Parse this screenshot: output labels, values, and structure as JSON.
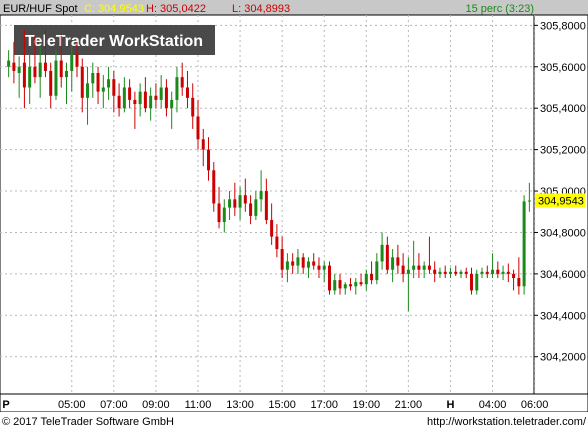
{
  "header": {
    "symbol": "EUR/HUF Spot",
    "close_label": "C: 304,9543",
    "high_label": "H: 305,0422",
    "low_label": "L: 304,8993",
    "period": "15 perc (3:23)"
  },
  "watermark": "TeleTrader WorkStation",
  "footer": {
    "copyright": "© 2017 TeleTrader Software GmbH",
    "url": "http://workstation.teletrader.com/"
  },
  "colors": {
    "up": "#1a8a1a",
    "down": "#cc0000",
    "grid": "#b8b8b8",
    "header_bg": "#c8c8c8",
    "close_highlight": "#ffff00",
    "price_marker": "#ffff00",
    "close_text": "#ffff00",
    "high_text": "#cc0000",
    "low_text": "#cc0000",
    "period_text": "#1a8a1a"
  },
  "chart_data": {
    "type": "candlestick",
    "y_ticks": [
      "305,8000",
      "305,6000",
      "305,4000",
      "305,2000",
      "305,0000",
      "304,8000",
      "304,6000",
      "304,4000",
      "304,2000"
    ],
    "y_tick_values": [
      305.8,
      305.6,
      305.4,
      305.2,
      305.0,
      304.8,
      304.6,
      304.4,
      304.2
    ],
    "ylim": [
      304.02,
      305.85
    ],
    "x_ticks": [
      "P",
      "05:00",
      "07:00",
      "09:00",
      "11:00",
      "13:00",
      "15:00",
      "17:00",
      "19:00",
      "21:00",
      "H",
      "04:00",
      "06:00"
    ],
    "x_tick_slots": [
      0,
      12,
      20,
      28,
      36,
      44,
      52,
      60,
      68,
      76,
      84,
      92,
      100
    ],
    "last_price_label": "304,9543",
    "last_price": 304.9543,
    "ohlc": [
      [
        305.6,
        305.68,
        305.55,
        305.63
      ],
      [
        305.62,
        305.72,
        305.52,
        305.58
      ],
      [
        305.57,
        305.65,
        305.45,
        305.6
      ],
      [
        305.62,
        305.78,
        305.4,
        305.5
      ],
      [
        305.5,
        305.66,
        305.42,
        305.6
      ],
      [
        305.6,
        305.75,
        305.52,
        305.55
      ],
      [
        305.55,
        305.7,
        305.45,
        305.62
      ],
      [
        305.62,
        305.78,
        305.55,
        305.58
      ],
      [
        305.58,
        305.62,
        305.4,
        305.46
      ],
      [
        305.46,
        305.68,
        305.44,
        305.63
      ],
      [
        305.63,
        305.75,
        305.5,
        305.55
      ],
      [
        305.55,
        305.62,
        305.42,
        305.58
      ],
      [
        305.58,
        305.7,
        305.48,
        305.66
      ],
      [
        305.66,
        305.72,
        305.55,
        305.6
      ],
      [
        305.6,
        305.64,
        305.38,
        305.45
      ],
      [
        305.45,
        305.6,
        305.32,
        305.52
      ],
      [
        305.52,
        305.62,
        305.45,
        305.57
      ],
      [
        305.57,
        305.6,
        305.42,
        305.48
      ],
      [
        305.48,
        305.56,
        305.4,
        305.5
      ],
      [
        305.5,
        305.6,
        305.44,
        305.54
      ],
      [
        305.54,
        305.58,
        305.38,
        305.46
      ],
      [
        305.46,
        305.52,
        305.36,
        305.4
      ],
      [
        305.4,
        305.55,
        305.38,
        305.5
      ],
      [
        305.5,
        305.54,
        305.4,
        305.44
      ],
      [
        305.44,
        305.48,
        305.3,
        305.42
      ],
      [
        305.42,
        305.52,
        305.36,
        305.48
      ],
      [
        305.48,
        305.55,
        305.38,
        305.4
      ],
      [
        305.4,
        305.5,
        305.34,
        305.46
      ],
      [
        305.46,
        305.52,
        305.4,
        305.44
      ],
      [
        305.44,
        305.56,
        305.4,
        305.5
      ],
      [
        305.5,
        305.54,
        305.36,
        305.4
      ],
      [
        305.4,
        305.48,
        305.3,
        305.44
      ],
      [
        305.44,
        305.6,
        305.38,
        305.55
      ],
      [
        305.55,
        305.62,
        305.46,
        305.5
      ],
      [
        305.5,
        305.58,
        305.4,
        305.45
      ],
      [
        305.45,
        305.52,
        305.3,
        305.36
      ],
      [
        305.36,
        305.44,
        305.2,
        305.25
      ],
      [
        305.25,
        305.3,
        305.12,
        305.2
      ],
      [
        305.2,
        305.26,
        305.05,
        305.1
      ],
      [
        305.1,
        305.14,
        304.9,
        304.94
      ],
      [
        304.94,
        305.02,
        304.82,
        304.85
      ],
      [
        304.85,
        304.96,
        304.8,
        304.92
      ],
      [
        304.92,
        305.0,
        304.86,
        304.96
      ],
      [
        304.96,
        305.04,
        304.88,
        304.92
      ],
      [
        304.92,
        305.02,
        304.86,
        304.98
      ],
      [
        304.98,
        305.06,
        304.9,
        304.94
      ],
      [
        304.94,
        304.98,
        304.84,
        304.88
      ],
      [
        304.88,
        305.0,
        304.86,
        304.96
      ],
      [
        304.96,
        305.1,
        304.9,
        305.0
      ],
      [
        305.0,
        305.06,
        304.84,
        304.86
      ],
      [
        304.86,
        304.94,
        304.74,
        304.78
      ],
      [
        304.78,
        304.84,
        304.68,
        304.72
      ],
      [
        304.72,
        304.78,
        304.58,
        304.62
      ],
      [
        304.62,
        304.7,
        304.56,
        304.66
      ],
      [
        304.66,
        304.7,
        304.6,
        304.64
      ],
      [
        304.64,
        304.72,
        304.6,
        304.68
      ],
      [
        304.68,
        304.7,
        304.6,
        304.63
      ],
      [
        304.63,
        304.68,
        304.58,
        304.66
      ],
      [
        304.66,
        304.7,
        304.62,
        304.64
      ],
      [
        304.64,
        304.68,
        304.58,
        304.62
      ],
      [
        304.62,
        304.66,
        304.56,
        304.64
      ],
      [
        304.64,
        304.66,
        304.5,
        304.52
      ],
      [
        304.52,
        304.6,
        304.5,
        304.57
      ],
      [
        304.57,
        304.6,
        304.5,
        304.53
      ],
      [
        304.53,
        304.56,
        304.5,
        304.55
      ],
      [
        304.55,
        304.58,
        304.52,
        304.54
      ],
      [
        304.54,
        304.58,
        304.5,
        304.56
      ],
      [
        304.56,
        304.6,
        304.54,
        304.55
      ],
      [
        304.55,
        304.62,
        304.52,
        304.6
      ],
      [
        304.6,
        304.66,
        304.55,
        304.57
      ],
      [
        304.57,
        304.7,
        304.55,
        304.66
      ],
      [
        304.66,
        304.8,
        304.62,
        304.74
      ],
      [
        304.74,
        304.78,
        304.6,
        304.62
      ],
      [
        304.62,
        304.72,
        304.56,
        304.68
      ],
      [
        304.68,
        304.74,
        304.6,
        304.64
      ],
      [
        304.64,
        304.7,
        304.56,
        304.6
      ],
      [
        304.6,
        304.68,
        304.42,
        304.62
      ],
      [
        304.62,
        304.76,
        304.58,
        304.64
      ],
      [
        304.64,
        304.7,
        304.58,
        304.62
      ],
      [
        304.62,
        304.66,
        304.58,
        304.64
      ],
      [
        304.64,
        304.78,
        304.6,
        304.62
      ],
      [
        304.62,
        304.66,
        304.56,
        304.6
      ],
      [
        304.6,
        304.63,
        304.58,
        304.61
      ],
      [
        304.61,
        304.64,
        304.58,
        304.6
      ],
      [
        304.6,
        304.63,
        304.58,
        304.61
      ],
      [
        304.61,
        304.64,
        304.59,
        304.6
      ],
      [
        304.6,
        304.62,
        304.58,
        304.61
      ],
      [
        304.61,
        304.63,
        304.58,
        304.6
      ],
      [
        304.6,
        304.63,
        304.5,
        304.52
      ],
      [
        304.52,
        304.62,
        304.5,
        304.6
      ],
      [
        304.6,
        304.63,
        304.58,
        304.61
      ],
      [
        304.61,
        304.64,
        304.58,
        304.6
      ],
      [
        304.6,
        304.7,
        304.58,
        304.62
      ],
      [
        304.62,
        304.66,
        304.58,
        304.6
      ],
      [
        304.6,
        304.64,
        304.57,
        304.61
      ],
      [
        304.61,
        304.65,
        304.56,
        304.6
      ],
      [
        304.6,
        304.62,
        304.52,
        304.58
      ],
      [
        304.58,
        304.68,
        304.5,
        304.54
      ],
      [
        304.54,
        304.98,
        304.5,
        304.95
      ],
      [
        304.95,
        305.04,
        304.9,
        304.9543
      ]
    ]
  }
}
